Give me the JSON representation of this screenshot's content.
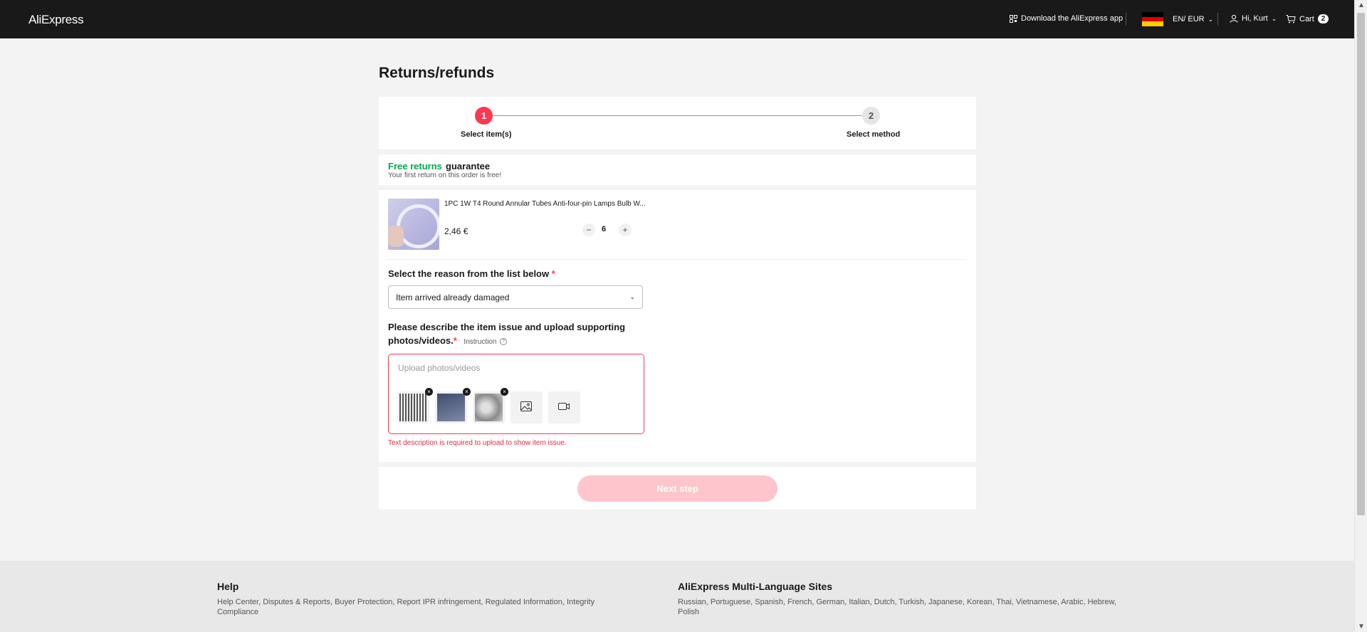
{
  "header": {
    "logo": "AliExpress",
    "download_app": "Download the AliExpress app",
    "lang_currency": "EN/ EUR",
    "user_greeting": "Hi, Kurt",
    "cart_label": "Cart",
    "cart_count": "2",
    "flag_colors": [
      "#000000",
      "#dd0000",
      "#ffce00"
    ]
  },
  "page": {
    "title": "Returns/refunds"
  },
  "stepper": {
    "steps": [
      {
        "number": "1",
        "label": "Select item(s)",
        "active": true
      },
      {
        "number": "2",
        "label": "Select method",
        "active": false
      }
    ]
  },
  "guarantee": {
    "highlight": "Free returns",
    "text": "guarantee",
    "subtitle": "Your first return on this order is free!"
  },
  "item": {
    "title": "1PC 1W T4 Round Annular Tubes Anti-four-pin Lamps Bulb W...",
    "price": "2,46 €",
    "quantity": "6",
    "minus_symbol": "−",
    "plus_symbol": "+"
  },
  "reason": {
    "label": "Select the reason from the list below",
    "required_mark": "*",
    "selected": "Item arrived already damaged"
  },
  "description": {
    "label": "Please describe the item issue and upload supporting photos/videos.",
    "required_mark": "*",
    "instruction": "Instruction",
    "upload_placeholder": "Upload photos/videos",
    "uploaded_count": 3,
    "error": "Text description is required to upload to show item issue."
  },
  "actions": {
    "next_step": "Next step"
  },
  "footer": {
    "help_title": "Help",
    "help_links": "Help Center, Disputes & Reports, Buyer Protection, Report IPR infringement, Regulated Information, Integrity Compliance",
    "multilang_title": "AliExpress Multi-Language Sites",
    "multilang_links": "Russian, Portuguese, Spanish, French, German, Italian, Dutch, Turkish, Japanese, Korean, Thai, Vietnamese, Arabic, Hebrew, Polish"
  },
  "colors": {
    "accent": "#fd384f",
    "success": "#00a650",
    "header_bg": "#191919",
    "next_disabled": "#ffc5cc"
  }
}
